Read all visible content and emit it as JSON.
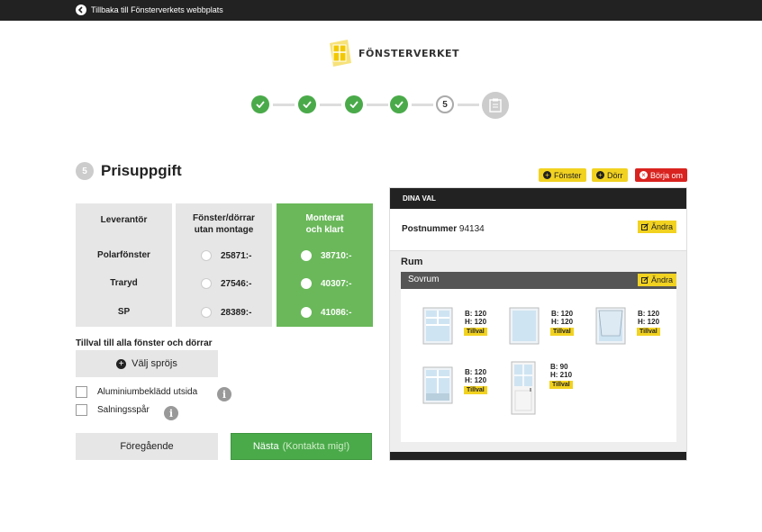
{
  "topbar": {
    "back_label": "Tillbaka till Fönsterverkets webbplats"
  },
  "logo": {
    "text": "FÖNSTERVERKET"
  },
  "steps": {
    "current": "5"
  },
  "page": {
    "number": "5",
    "title": "Prisuppgift"
  },
  "table": {
    "col1_header": "Leverantör",
    "col2_header_line1": "Fönster/dörrar",
    "col2_header_line2": "utan montage",
    "col3_header_line1": "Monterat",
    "col3_header_line2": "och klart",
    "rows": [
      {
        "supplier": "Polarfönster",
        "price_plain": "25871:-",
        "price_mounted": "38710:-"
      },
      {
        "supplier": "Traryd",
        "price_plain": "27546:-",
        "price_mounted": "40307:-"
      },
      {
        "supplier": "SP",
        "price_plain": "28389:-",
        "price_mounted": "41086:-"
      }
    ]
  },
  "options": {
    "label": "Tillval till alla fönster och dörrar",
    "sprojs_button": "Välj spröjs",
    "checkbox1": "Aluminiumbeklädd utsida",
    "checkbox2": "Salningsspår"
  },
  "nav": {
    "prev": "Föregående",
    "next": "Nästa",
    "next_sub": "(Kontakta mig!)"
  },
  "actions": {
    "fonster": "Fönster",
    "dorr": "Dörr",
    "borja_om": "Börja om"
  },
  "panel": {
    "header": "DINA VAL",
    "postnummer_label": "Postnummer",
    "postnummer_value": "94134",
    "andra": "Ändra",
    "rum_label": "Rum",
    "room_name": "Sovrum",
    "items": [
      {
        "b": "B: 120",
        "h": "H: 120",
        "tag": "Tillval"
      },
      {
        "b": "B: 120",
        "h": "H: 120",
        "tag": "Tillval"
      },
      {
        "b": "B: 120",
        "h": "H: 120",
        "tag": "Tillval"
      },
      {
        "b": "B: 120",
        "h": "H: 120",
        "tag": "Tillval"
      },
      {
        "b": "B: 90",
        "h": "H: 210",
        "tag": "Tillval"
      }
    ]
  },
  "colors": {
    "green": "#4aaa4a",
    "yellow": "#f2d220",
    "red": "#d9231f",
    "dark": "#222222"
  }
}
